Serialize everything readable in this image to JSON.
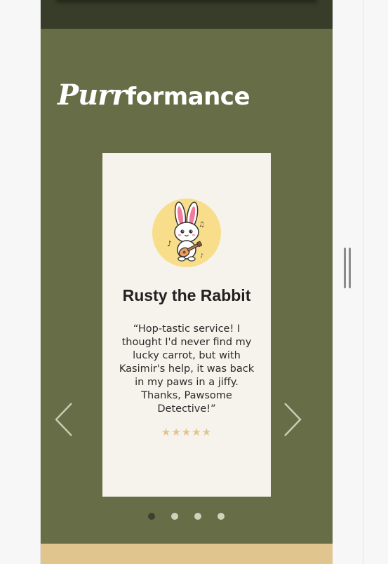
{
  "section": {
    "title_script": "Purr",
    "title_bold": "formance"
  },
  "carousel": {
    "active_index": 0,
    "card": {
      "avatar_icon": "rabbit-with-ukulele-icon",
      "name": "Rusty the Rabbit",
      "quote": "“Hop-tastic service! I thought I'd never find my lucky carrot, but with Kasimir's help, it was back in my paws in a jiffy. Thanks, Pawsome Detective!”",
      "rating": 5,
      "stars": "★★★★★"
    },
    "dot_count": 4,
    "prev_icon": "chevron-left-icon",
    "next_icon": "chevron-right-icon"
  },
  "colors": {
    "section_bg": "#676d46",
    "top_band": "#373d28",
    "bottom_band": "#e1c58f",
    "card_bg": "#f6f3ec",
    "avatar_bg": "#f8de8b",
    "star": "#e4c48c",
    "dot_active": "#3c4030",
    "dot_inactive": "#cfd2bd"
  }
}
